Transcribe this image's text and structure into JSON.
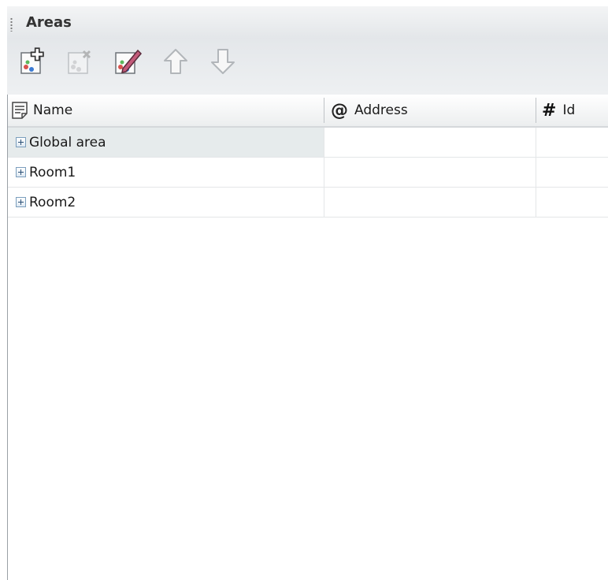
{
  "panel": {
    "title": "Areas"
  },
  "toolbar": {
    "buttons": [
      {
        "name": "add-area",
        "icon": "add-area-icon",
        "enabled": true
      },
      {
        "name": "delete-area",
        "icon": "delete-area-icon",
        "enabled": false
      },
      {
        "name": "edit-area",
        "icon": "edit-area-icon",
        "enabled": true
      },
      {
        "name": "move-up",
        "icon": "arrow-up-icon",
        "enabled": false
      },
      {
        "name": "move-down",
        "icon": "arrow-down-icon",
        "enabled": false
      }
    ]
  },
  "grid": {
    "columns": [
      {
        "label": "Name",
        "icon": "document-list-icon"
      },
      {
        "label": "Address",
        "icon": "at-sign-icon",
        "symbol": "@"
      },
      {
        "label": "Id",
        "icon": "hash-icon",
        "symbol": "#"
      }
    ],
    "rows": [
      {
        "name": "Global area",
        "address": "",
        "id": "",
        "selected": true
      },
      {
        "name": "Room1",
        "address": "",
        "id": "",
        "selected": false
      },
      {
        "name": "Room2",
        "address": "",
        "id": "",
        "selected": false
      }
    ]
  }
}
